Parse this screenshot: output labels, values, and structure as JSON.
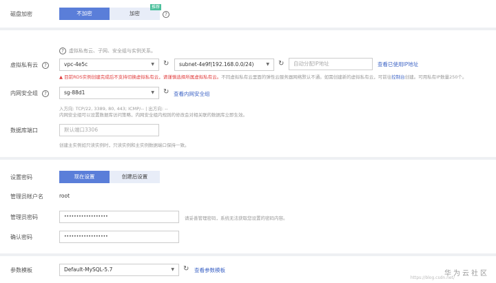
{
  "disk_encryption": {
    "label": "磁盘加密",
    "options": [
      "不加密",
      "加密"
    ],
    "selected": "不加密",
    "badge": "推荐"
  },
  "vpc": {
    "label": "虚拟私有云",
    "hint": "虚拟私有云、子网、安全组与实例关系。",
    "vpc_value": "vpc-4e5c",
    "subnet_value": "subnet-4e9f(192.168.0.0/24)",
    "ip_placeholder": "自动分配IP地址",
    "view_ip_link": "查看已使用IP地址",
    "warning_red": "目前RDS实例创建完成后不支持切换虚拟私有云，请谨慎选择所属虚拟私有云。",
    "warning_gray": "不同虚拟私有云里面的弹性云服务器网络默认不通。如需创建新的虚拟私有云，可前往",
    "warning_link": "控制台",
    "warning_tail": "创建。可用私有IP数量250个。"
  },
  "security_group": {
    "label": "内网安全组",
    "value": "sg-88d1",
    "link": "查看内网安全组",
    "rules": "入方向: TCP/22, 3389, 80, 443; ICMP/-- | 出方向: --",
    "hint": "内网安全组可以设置数据库访问策略，内网安全组内规则的修改会对相关联的数据库立即生效。"
  },
  "db_port": {
    "label": "数据库端口",
    "placeholder": "默认端口3306",
    "hint": "创建主实例如只读实例时，只读实例和主实例数据端口保持一致。"
  },
  "password_setting": {
    "label": "设置密码",
    "options": [
      "现在设置",
      "创建后设置"
    ],
    "selected": "现在设置"
  },
  "admin_user": {
    "label": "管理员帐户名",
    "value": "root"
  },
  "admin_password": {
    "label": "管理员密码",
    "value": "••••••••••••••••••",
    "hint": "请妥善管理密码，系统无法获取您设置的密码内容。"
  },
  "confirm_password": {
    "label": "确认密码",
    "value": "••••••••••••••••••"
  },
  "param_template": {
    "label": "参数模板",
    "value": "Default-MySQL-5.7",
    "link": "查看参数模板"
  },
  "watermark": {
    "brand": "华为云社区",
    "url": "https://blog.csdn.net/"
  },
  "colors": {
    "accent": "#5a7ed9",
    "link": "#3e64c6",
    "warning": "#e03c3c",
    "badge": "#4cc09c"
  }
}
